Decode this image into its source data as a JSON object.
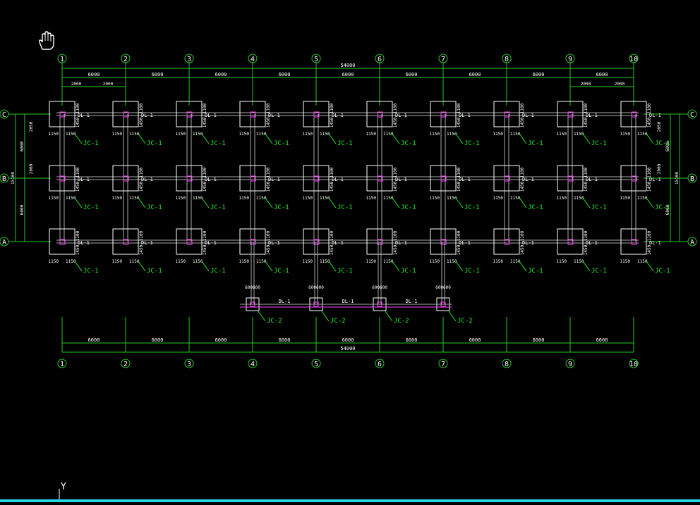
{
  "colors": {
    "background": "#000000",
    "axis_line": "#22c922",
    "dimension": "#22c922",
    "beam": "#a8a8a8",
    "column": "#ff40ff",
    "footing": "#ffffff",
    "text": "#ffffff",
    "label": "#22ee22",
    "status_bar": "#24d6e0"
  },
  "axes": {
    "numbered": [
      "1",
      "2",
      "3",
      "4",
      "5",
      "6",
      "7",
      "8",
      "9",
      "10"
    ],
    "lettered": [
      "C",
      "B",
      "A"
    ]
  },
  "dimensions": {
    "overall_length": "54000",
    "bay": "6000",
    "sub_bay": "2000",
    "overall_depth": "15100",
    "row_span_cb": "6000",
    "row_span_ba": "6000",
    "sub_vert_top": "2050",
    "sub_vert_mid": "1950",
    "sub_vert_b": "2000",
    "foot_w": "1150",
    "foot_w2": "1450",
    "foot_w3": "1100",
    "foot_w4": "1050",
    "foot_w5": "1250",
    "foot_w6": "1275",
    "foot_offset": "175",
    "foot_small": "250",
    "foot_small2": "200",
    "foot_small3": "150",
    "foot_small4": "100",
    "ext_foot": "600600",
    "section_mark": "1"
  },
  "labels": {
    "footing_main": "JC-1",
    "footing_ext": "JC-2",
    "beam": "DL-1"
  },
  "ucs": {
    "y_label": "Y"
  },
  "icons": {
    "cursor": "pan-hand-icon",
    "ucs": "ucs-icon"
  }
}
